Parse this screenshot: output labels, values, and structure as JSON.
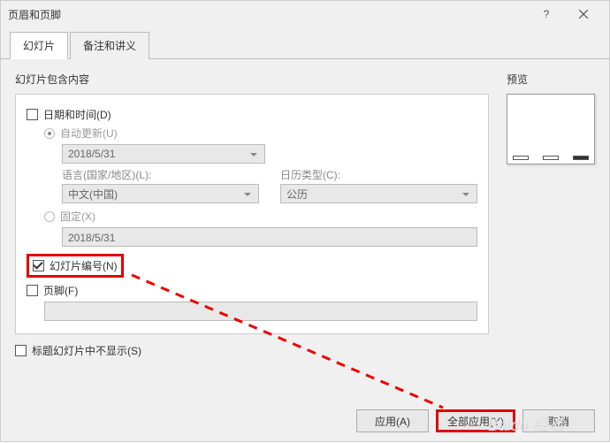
{
  "window": {
    "title": "页眉和页脚"
  },
  "tabs": {
    "slide": "幻灯片",
    "notes": "备注和讲义"
  },
  "content": {
    "includes_label": "幻灯片包含内容",
    "datetime": {
      "label": "日期和时间(D)",
      "auto": {
        "label": "自动更新(U)",
        "value": "2018/5/31"
      },
      "lang_label": "语言(国家/地区)(L):",
      "lang_value": "中文(中国)",
      "calendar_label": "日历类型(C):",
      "calendar_value": "公历",
      "fixed": {
        "label": "固定(X)",
        "value": "2018/5/31"
      }
    },
    "slide_number": {
      "label": "幻灯片编号(N)"
    },
    "footer": {
      "label": "页脚(F)"
    },
    "hide_title": {
      "label": "标题幻灯片中不显示(S)"
    }
  },
  "preview": {
    "label": "预览"
  },
  "buttons": {
    "apply": "应用(A)",
    "apply_all": "全部应用(Y)",
    "cancel": "取消"
  },
  "watermark": "Baidu 经验"
}
